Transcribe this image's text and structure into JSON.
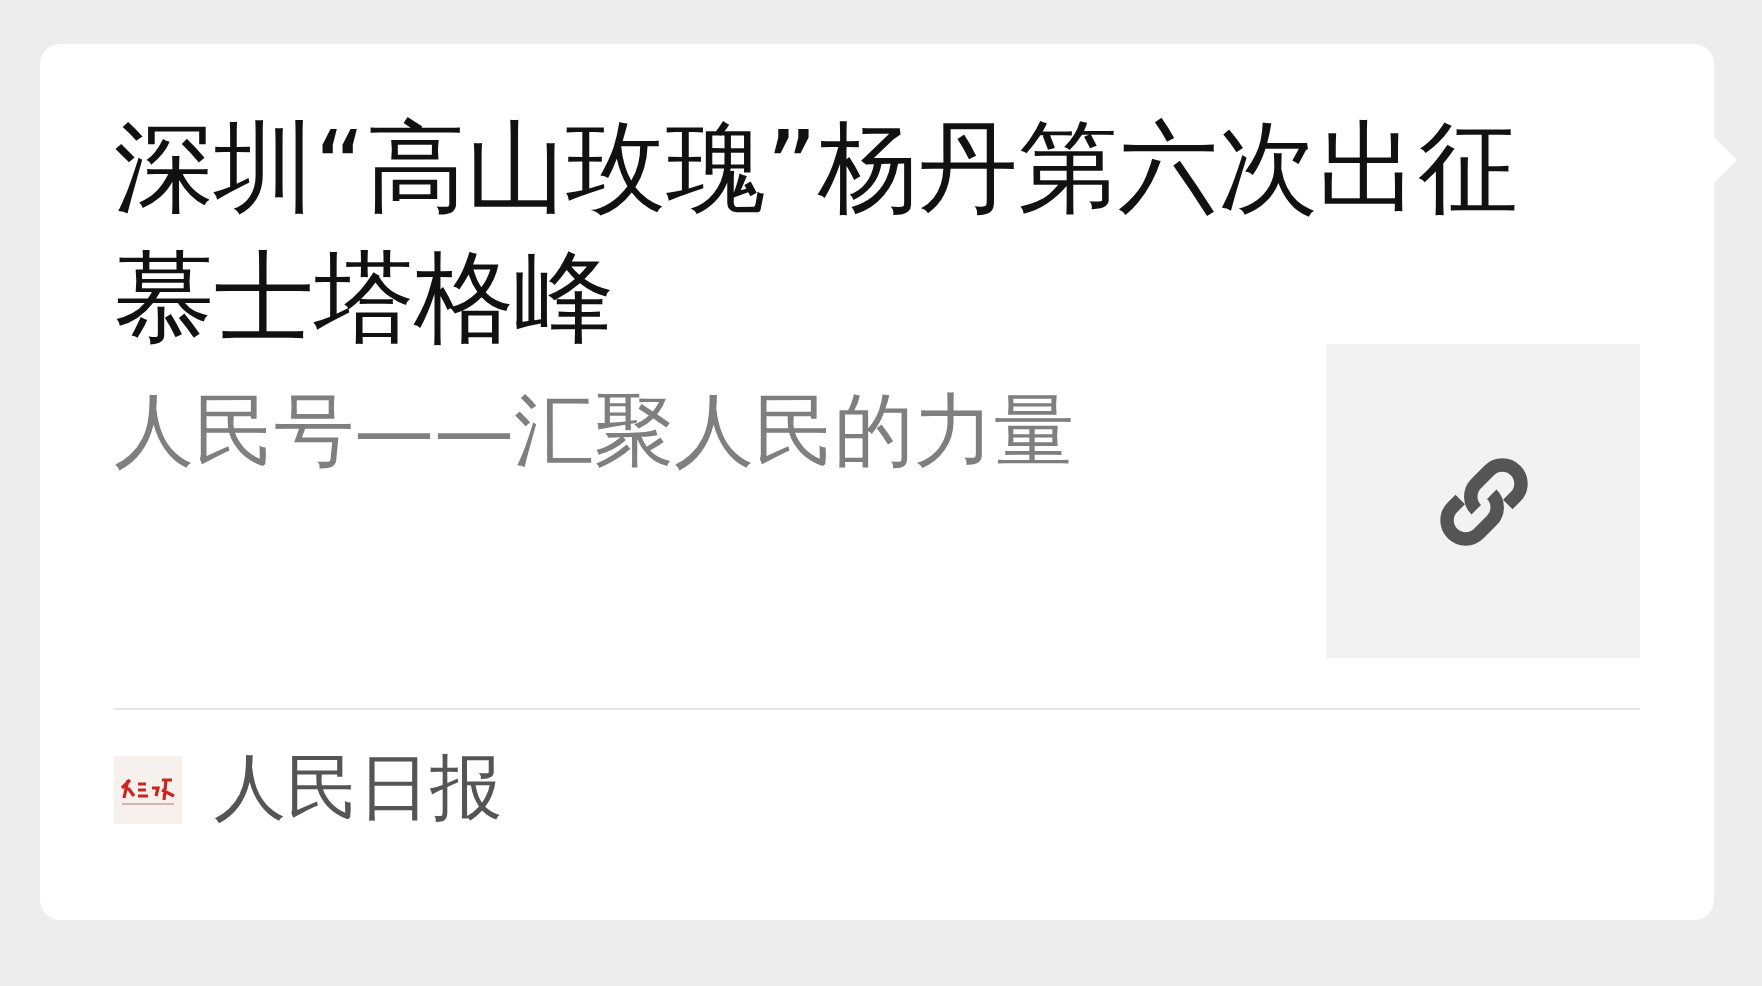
{
  "card": {
    "title": "深圳“高山玫瑰”杨丹第六次出征慕士塔格峰",
    "subtitle": "人民号——汇聚人民的力量",
    "source": "人民日报"
  }
}
